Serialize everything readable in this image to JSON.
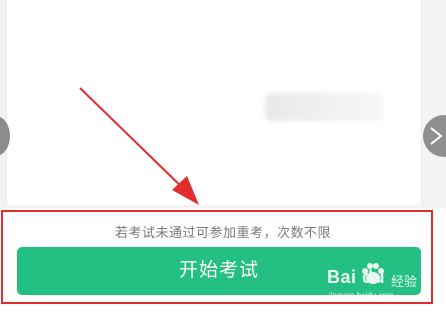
{
  "hint_text": "若考试未通过可参加重考，次数不限",
  "start_button_label": "开始考试",
  "watermark": {
    "logo": "Bai du",
    "subtitle": "经验",
    "url": "jingyan.baidu.com"
  },
  "colors": {
    "button": "#24c083",
    "highlight": "#e02d2d",
    "hint_text": "#7a7a7a"
  },
  "icons": [
    "chevron-left-icon",
    "chevron-right-icon",
    "baidu-paw-icon"
  ]
}
